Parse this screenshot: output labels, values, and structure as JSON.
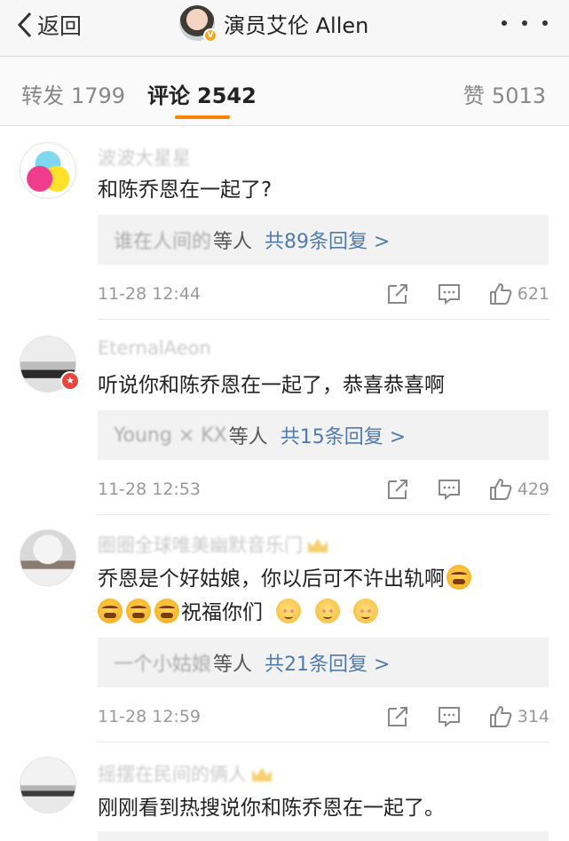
{
  "header": {
    "back_label": "返回",
    "title": "演员艾伦 Allen",
    "verified_badge": "V"
  },
  "tabs": {
    "repost": {
      "label": "转发",
      "count": "1799"
    },
    "comment": {
      "label": "评论",
      "count": "2542"
    },
    "like": {
      "label": "赞",
      "count": "5013"
    }
  },
  "colors": {
    "accent": "#ff8200",
    "link": "#4f7bb0",
    "muted": "#999999"
  },
  "comments": [
    {
      "username": "波波大星星",
      "text": "和陈乔恩在一起了?",
      "reply_names": "谁在人间的",
      "reply_etc": "等人",
      "reply_more": "共89条回复 >",
      "time": "11-28 12:44",
      "likes": "621"
    },
    {
      "username": "EternalAeon",
      "text": "听说你和陈乔恩在一起了，恭喜恭喜啊",
      "reply_names": "Young × KX",
      "reply_etc": "等人",
      "reply_more": "共15条回复 >",
      "time": "11-28 12:53",
      "likes": "429"
    },
    {
      "username": "圈圈全球唯美幽默音乐门",
      "text_line1": "乔恩是个好姑娘，你以后可不许出轨啊",
      "text_line2": "祝福你们",
      "reply_names": "一个小姑娘",
      "reply_etc": "等人",
      "reply_more": "共21条回复 >",
      "time": "11-28 12:59",
      "likes": "314"
    },
    {
      "username": "摇摆在民间的俩人",
      "text": "刚刚看到热搜说你和陈乔恩在一起了。"
    }
  ]
}
